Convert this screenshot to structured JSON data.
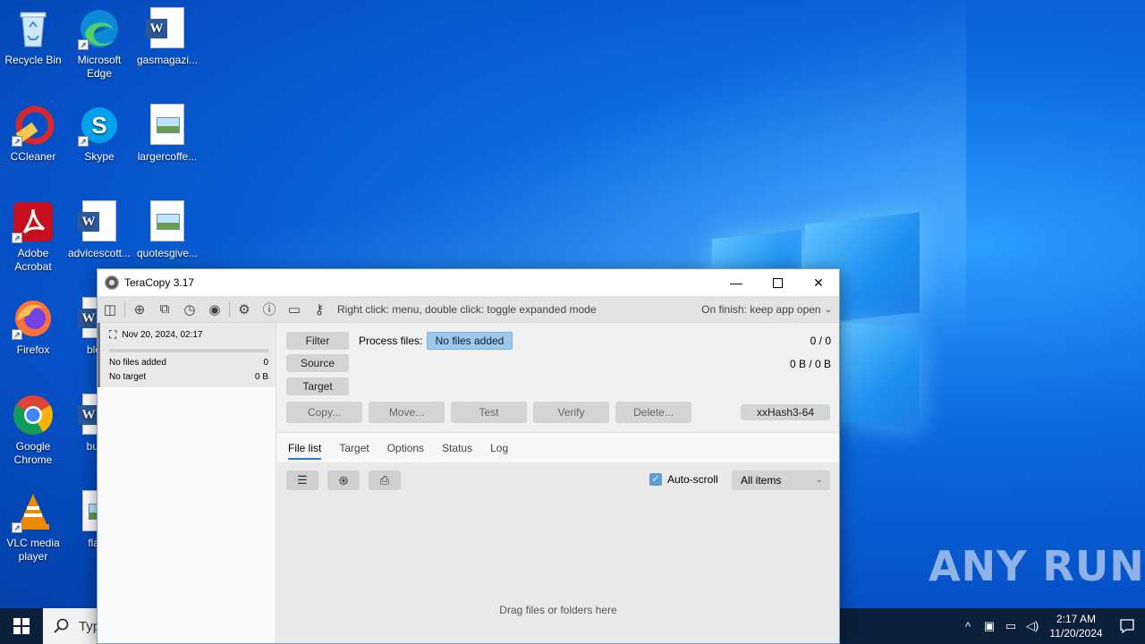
{
  "desktop": {
    "icons": [
      {
        "label": "Recycle Bin",
        "kind": "recycle-bin-icon"
      },
      {
        "label": "Microsoft Edge",
        "kind": "edge-icon"
      },
      {
        "label": "gasmagazi...",
        "kind": "word-doc-icon"
      },
      {
        "label": "CCleaner",
        "kind": "ccleaner-icon"
      },
      {
        "label": "Skype",
        "kind": "skype-icon"
      },
      {
        "label": "largercoffe...",
        "kind": "image-file-icon"
      },
      {
        "label": "Adobe Acrobat",
        "kind": "acrobat-icon"
      },
      {
        "label": "advicescott...",
        "kind": "word-doc-icon"
      },
      {
        "label": "quotesgive...",
        "kind": "image-file-icon"
      },
      {
        "label": "Firefox",
        "kind": "firefox-icon"
      },
      {
        "label": "block",
        "kind": "word-doc-icon"
      },
      {
        "label": "Google Chrome",
        "kind": "chrome-icon"
      },
      {
        "label": "busin",
        "kind": "word-doc-icon"
      },
      {
        "label": "VLC media player",
        "kind": "vlc-icon"
      },
      {
        "label": "flash",
        "kind": "image-file-icon"
      }
    ],
    "watermark": "ANY RUN"
  },
  "taskbar": {
    "search_placeholder": "Typ",
    "time": "2:17 AM",
    "date": "11/20/2024"
  },
  "window": {
    "title": "TeraCopy 3.17",
    "toolbar_hint": "Right click: menu, double click: toggle expanded mode",
    "on_finish": "On finish: keep app open",
    "left_panel": {
      "datetime": "Nov 20, 2024, 02:17",
      "rows": [
        {
          "label": "No files added",
          "value": "0"
        },
        {
          "label": "No target",
          "value": "0 B"
        }
      ]
    },
    "buttons": {
      "filter": "Filter",
      "source": "Source",
      "target": "Target",
      "copy": "Copy...",
      "move": "Move...",
      "test": "Test",
      "verify": "Verify",
      "delete": "Delete...",
      "hash": "xxHash3-64"
    },
    "process_label": "Process files:",
    "process_value": "No files added",
    "count_files": "0 / 0",
    "count_bytes": "0 B / 0 B",
    "tabs": [
      "File list",
      "Target",
      "Options",
      "Status",
      "Log"
    ],
    "auto_scroll_label": "Auto-scroll",
    "auto_scroll_checked": true,
    "filter_select": "All items",
    "empty_message": "Drag files or folders here"
  },
  "colors": {
    "accent": "#2b7bd6",
    "process_badge": "#9cc8ec",
    "taskbar": "#0c1f3b"
  }
}
